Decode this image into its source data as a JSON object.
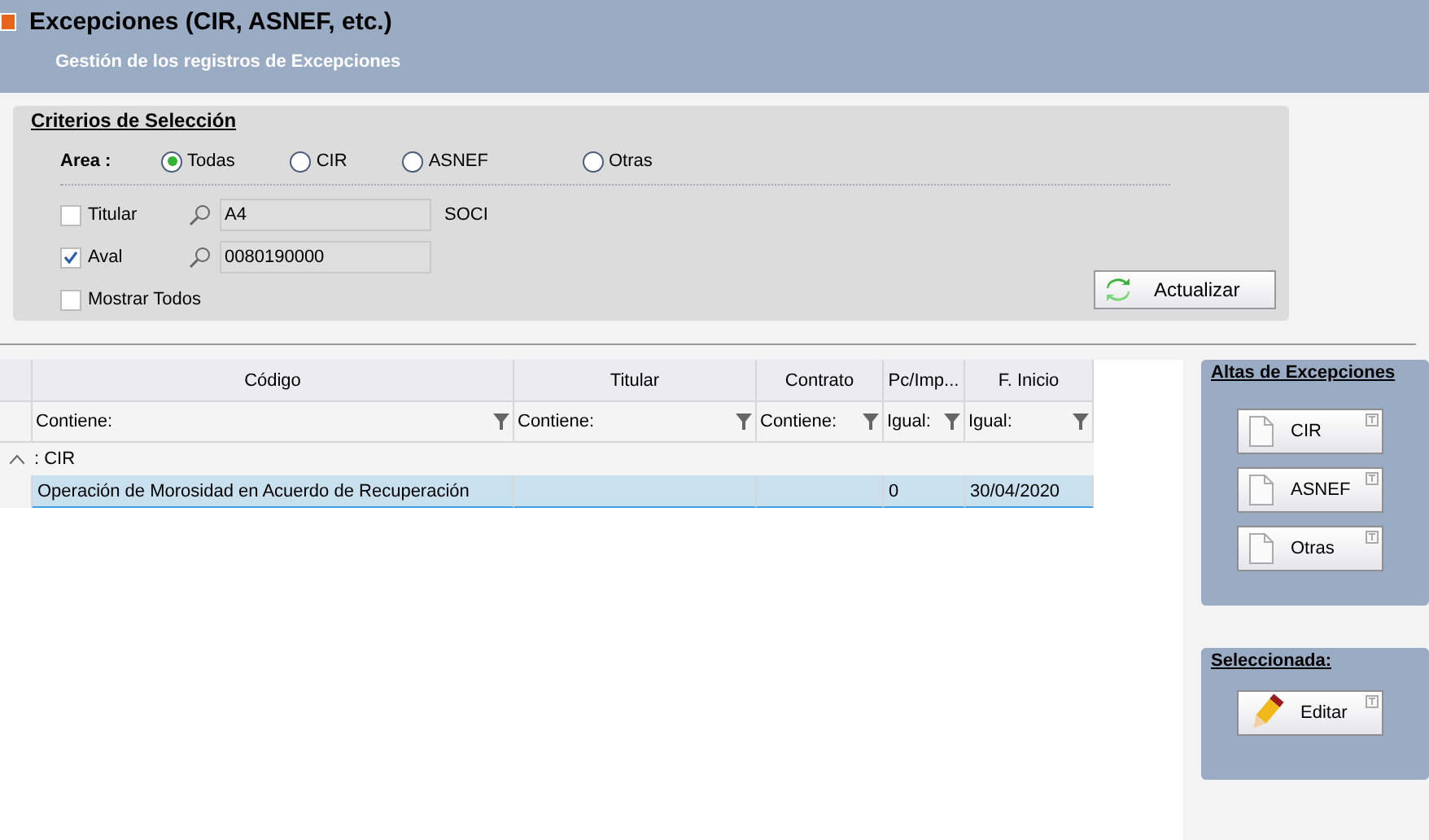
{
  "header": {
    "title": "Excepciones  (CIR, ASNEF, etc.)",
    "subtitle": "Gestión de los registros de Excepciones"
  },
  "criteria": {
    "title": "Criterios de Selección",
    "area_label": "Area :",
    "area_options": [
      {
        "label": "Todas",
        "selected": true
      },
      {
        "label": "CIR",
        "selected": false
      },
      {
        "label": "ASNEF",
        "selected": false
      },
      {
        "label": "Otras",
        "selected": false
      }
    ],
    "filters": [
      {
        "label": "Titular",
        "checked": false,
        "value": "A4",
        "description": "SOCI"
      },
      {
        "label": "Aval",
        "checked": true,
        "value": "0080190000"
      }
    ],
    "show_all": {
      "label": "Mostrar Todos",
      "checked": false
    },
    "refresh_button": "Actualizar"
  },
  "table": {
    "columns": [
      {
        "title": "Código",
        "filter": "Contiene:"
      },
      {
        "title": "Titular",
        "filter": "Contiene:"
      },
      {
        "title": "Contrato",
        "filter": "Contiene:"
      },
      {
        "title": "Pc/Imp...",
        "filter": "Igual:"
      },
      {
        "title": "F. Inicio",
        "filter": "Igual:"
      }
    ],
    "groups": [
      {
        "label": ": CIR",
        "expanded": true,
        "rows": [
          {
            "cells": [
              "Operación de Morosidad en Acuerdo de Recuperación",
              "",
              "",
              "0",
              "30/04/2020"
            ],
            "selected": true
          }
        ]
      }
    ]
  },
  "new_panel": {
    "title": "Altas de Excepciones",
    "buttons": [
      "CIR",
      "ASNEF",
      "Otras"
    ]
  },
  "selected_panel": {
    "title": "Seleccionada:",
    "buttons": [
      "Editar"
    ]
  }
}
